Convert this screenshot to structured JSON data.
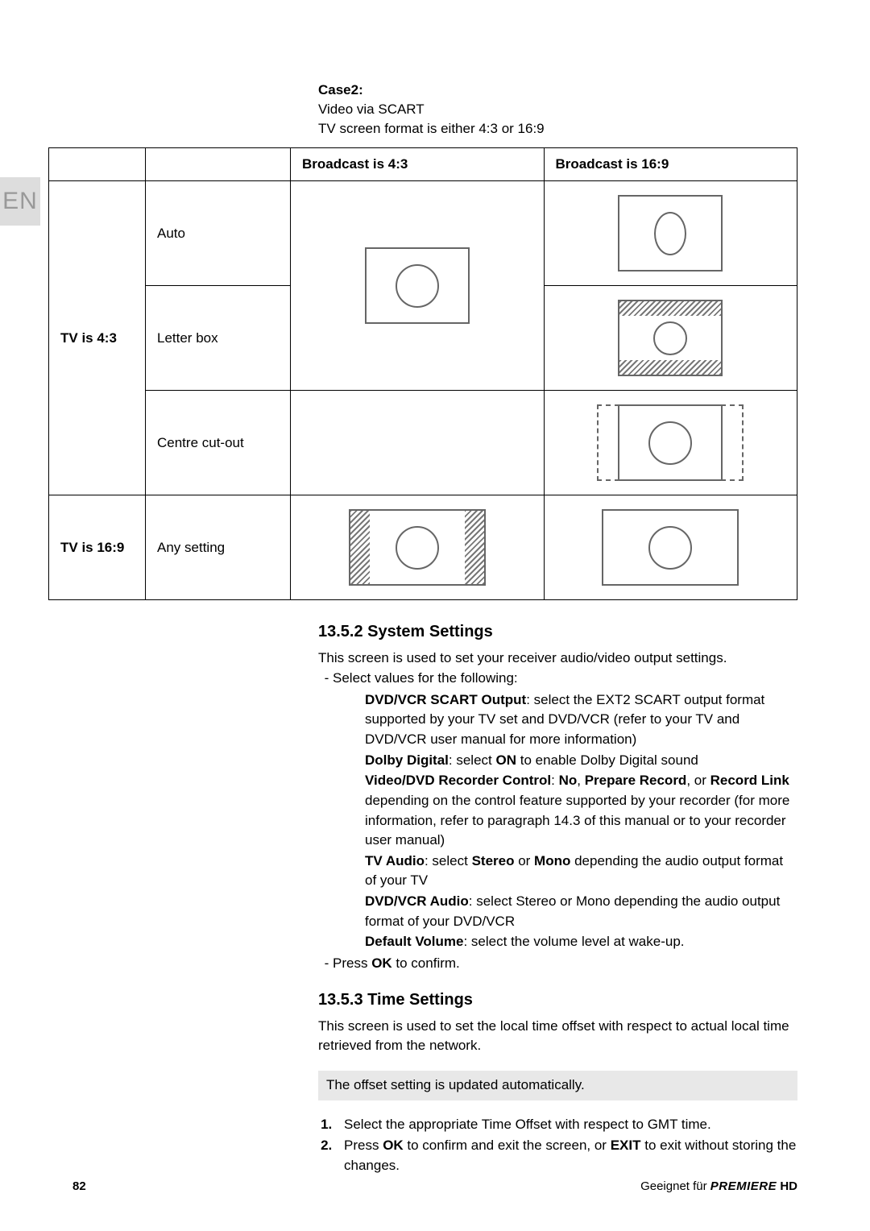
{
  "lang_tab": "EN",
  "case": {
    "label": "Case2:",
    "line1": "Video via SCART",
    "line2": "TV screen format is either 4:3 or 16:9"
  },
  "table": {
    "col_broadcast_43": "Broadcast is 4:3",
    "col_broadcast_169": "Broadcast is 16:9",
    "row_tv43": "TV is 4:3",
    "row_tv169": "TV is 16:9",
    "fmt_auto": "Auto",
    "fmt_letterbox": "Letter box",
    "fmt_centrecut": "Centre cut-out",
    "fmt_any": "Any setting"
  },
  "sys": {
    "heading": "13.5.2 System Settings",
    "intro": "This screen is used to set your receiver audio/video output settings.",
    "select_line": "Select values for the following:",
    "opts": {
      "dvdvcr_scart_label": "DVD/VCR SCART Output",
      "dvdvcr_scart_text": ": select the EXT2 SCART output format supported by your TV set and DVD/VCR (refer to your TV and DVD/VCR user manual for more information)",
      "dolby_label": "Dolby Digital",
      "dolby_text_a": ": select ",
      "dolby_on": "ON",
      "dolby_text_b": " to enable Dolby Digital sound",
      "recorder_label": "Video/DVD Recorder Control",
      "recorder_text_a": ": ",
      "recorder_no": "No",
      "recorder_sep1": ", ",
      "recorder_prep": "Prepare Record",
      "recorder_sep2": ", or ",
      "recorder_link": "Record Link",
      "recorder_text_b": " depending on the control feature supported by your recorder (for more information, refer to paragraph 14.3 of this manual or to your recorder user manual)",
      "tvaudio_label": "TV Audio",
      "tvaudio_text_a": ": select ",
      "tvaudio_stereo": "Stereo",
      "tvaudio_or": " or ",
      "tvaudio_mono": "Mono",
      "tvaudio_text_b": " depending the audio output format of your TV",
      "dvdvcr_audio_label": "DVD/VCR Audio",
      "dvdvcr_audio_text": ": select Stereo or Mono depending the audio output format of your DVD/VCR",
      "defvol_label": "Default Volume",
      "defvol_text": ": select the volume level at wake-up."
    },
    "press_ok_a": "Press ",
    "press_ok_b": "OK",
    "press_ok_c": " to confirm."
  },
  "time": {
    "heading": "13.5.3 Time Settings",
    "intro": "This screen is used to set the local time offset with respect to actual local time retrieved from the network.",
    "note": "The offset setting is updated automatically.",
    "step1": "Select the appropriate Time Offset with respect to GMT time.",
    "step2_a": "Press ",
    "step2_ok": "OK",
    "step2_b": " to confirm and exit the screen, or ",
    "step2_exit": "EXIT",
    "step2_c": " to exit without storing the changes."
  },
  "footer": {
    "page": "82",
    "text": "Geeignet für ",
    "brand": "PREMIERE",
    "hd": "HD"
  }
}
